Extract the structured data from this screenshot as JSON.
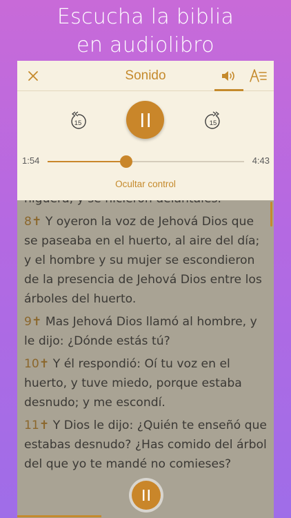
{
  "headline": {
    "line1": "Escucha la biblia",
    "line2": "en audiolibro"
  },
  "toolbar": {
    "title": "Sonido",
    "close_icon": "close-icon",
    "sound_icon": "speaker-icon",
    "font_icon": "text-format-icon"
  },
  "player": {
    "skip_back_label": "15",
    "skip_forward_label": "15",
    "state": "playing",
    "elapsed": "1:54",
    "duration": "4:43",
    "progress_fraction": 0.4,
    "hide_controls_label": "Ocultar control"
  },
  "reader": {
    "partial_line": "higuera, y se hicieron delantales.",
    "verses": [
      {
        "num": "8",
        "text": "Y oyeron la voz de Jehová Dios que se paseaba en el huerto, al aire del día; y el hombre y su mujer se escondieron de la presencia de Jehová Dios entre los árboles del huerto."
      },
      {
        "num": "9",
        "text": "Mas Jehová Dios llamó al hombre, y le dijo: ¿Dónde estás tú?"
      },
      {
        "num": "10",
        "text": "Y él respondió: Oí tu voz en el huerto, y tuve miedo, porque estaba desnudo; y me escondí."
      },
      {
        "num": "11",
        "text": "Y Dios le dijo: ¿Quién te enseñó que estabas desnudo? ¿Has comido del árbol del que yo te mandé no comieses?"
      }
    ]
  },
  "colors": {
    "accent": "#c9862a",
    "background_top": "#c86ad8",
    "background_bottom": "#9f6de8",
    "panel": "#f7f1e1"
  }
}
